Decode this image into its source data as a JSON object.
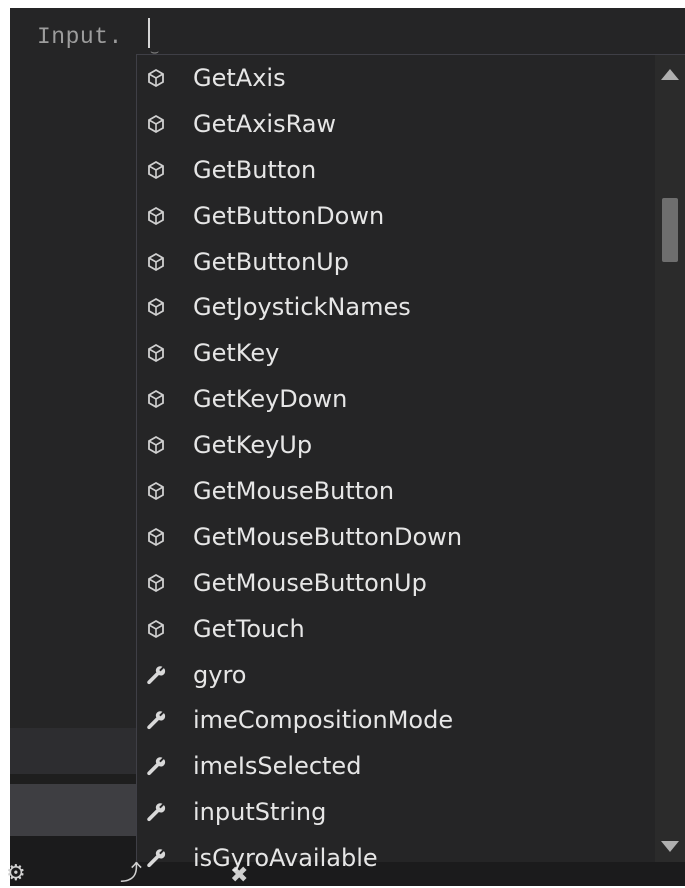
{
  "editor": {
    "code_text": "Input."
  },
  "completion": {
    "items": [
      {
        "label": "GetAxis",
        "kind": "method",
        "icon": "method-cube-icon"
      },
      {
        "label": "GetAxisRaw",
        "kind": "method",
        "icon": "method-cube-icon"
      },
      {
        "label": "GetButton",
        "kind": "method",
        "icon": "method-cube-icon"
      },
      {
        "label": "GetButtonDown",
        "kind": "method",
        "icon": "method-cube-icon"
      },
      {
        "label": "GetButtonUp",
        "kind": "method",
        "icon": "method-cube-icon"
      },
      {
        "label": "GetJoystickNames",
        "kind": "method",
        "icon": "method-cube-icon"
      },
      {
        "label": "GetKey",
        "kind": "method",
        "icon": "method-cube-icon"
      },
      {
        "label": "GetKeyDown",
        "kind": "method",
        "icon": "method-cube-icon"
      },
      {
        "label": "GetKeyUp",
        "kind": "method",
        "icon": "method-cube-icon"
      },
      {
        "label": "GetMouseButton",
        "kind": "method",
        "icon": "method-cube-icon"
      },
      {
        "label": "GetMouseButtonDown",
        "kind": "method",
        "icon": "method-cube-icon"
      },
      {
        "label": "GetMouseButtonUp",
        "kind": "method",
        "icon": "method-cube-icon"
      },
      {
        "label": "GetTouch",
        "kind": "method",
        "icon": "method-cube-icon"
      },
      {
        "label": "gyro",
        "kind": "property",
        "icon": "property-wrench-icon"
      },
      {
        "label": "imeCompositionMode",
        "kind": "property",
        "icon": "property-wrench-icon"
      },
      {
        "label": "imeIsSelected",
        "kind": "property",
        "icon": "property-wrench-icon"
      },
      {
        "label": "inputString",
        "kind": "property",
        "icon": "property-wrench-icon"
      },
      {
        "label": "isGyroAvailable",
        "kind": "property",
        "icon": "property-wrench-icon"
      }
    ]
  },
  "colors": {
    "popup_bg": "#252526",
    "text": "#e6e6e6",
    "icon": "#d0d0d0"
  }
}
